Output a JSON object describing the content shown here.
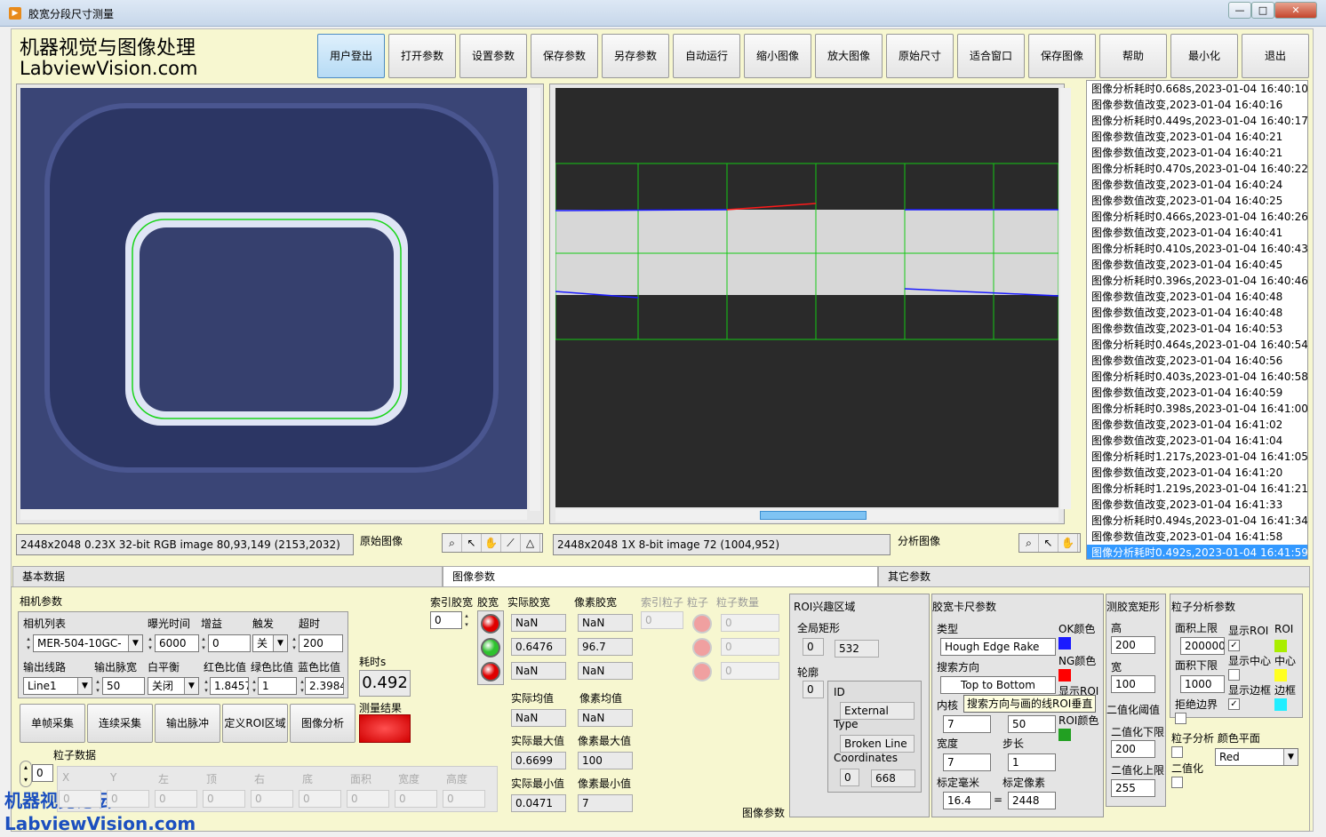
{
  "window": {
    "title": "胶宽分段尺寸测量",
    "min": "—",
    "max": "□",
    "close": "✕"
  },
  "brand": {
    "line1": "机器视觉与图像处理",
    "line2": "LabviewVision.com"
  },
  "toolbar": [
    "用户登出",
    "打开参数",
    "设置参数",
    "保存参数",
    "另存参数",
    "自动运行",
    "缩小图像",
    "放大图像",
    "原始尺寸",
    "适合窗口",
    "保存图像",
    "帮助",
    "最小化",
    "退出"
  ],
  "left_view": {
    "status": "2448x2048 0.23X 32-bit RGB image 80,93,149    (2153,2032)",
    "label": "原始图像"
  },
  "right_view": {
    "status": "2448x2048 1X 8-bit image 72    (1004,952)",
    "label": "分析图像"
  },
  "log": [
    "图像分析耗时0.668s,2023-01-04 16:40:10",
    "图像参数值改变,2023-01-04 16:40:16",
    "图像分析耗时0.449s,2023-01-04 16:40:17",
    "图像参数值改变,2023-01-04 16:40:21",
    "图像参数值改变,2023-01-04 16:40:21",
    "图像分析耗时0.470s,2023-01-04 16:40:22",
    "图像参数值改变,2023-01-04 16:40:24",
    "图像参数值改变,2023-01-04 16:40:25",
    "图像分析耗时0.466s,2023-01-04 16:40:26",
    "图像参数值改变,2023-01-04 16:40:41",
    "图像分析耗时0.410s,2023-01-04 16:40:43",
    "图像参数值改变,2023-01-04 16:40:45",
    "图像分析耗时0.396s,2023-01-04 16:40:46",
    "图像参数值改变,2023-01-04 16:40:48",
    "图像参数值改变,2023-01-04 16:40:48",
    "图像参数值改变,2023-01-04 16:40:53",
    "图像分析耗时0.464s,2023-01-04 16:40:54",
    "图像参数值改变,2023-01-04 16:40:56",
    "图像分析耗时0.403s,2023-01-04 16:40:58",
    "图像参数值改变,2023-01-04 16:40:59",
    "图像分析耗时0.398s,2023-01-04 16:41:00",
    "图像参数值改变,2023-01-04 16:41:02",
    "图像参数值改变,2023-01-04 16:41:04",
    "图像分析耗时1.217s,2023-01-04 16:41:05",
    "图像参数值改变,2023-01-04 16:41:20",
    "图像分析耗时1.219s,2023-01-04 16:41:21",
    "图像参数值改变,2023-01-04 16:41:33",
    "图像分析耗时0.494s,2023-01-04 16:41:34",
    "图像参数值改变,2023-01-04 16:41:58",
    "图像分析耗时0.492s,2023-01-04 16:41:59"
  ],
  "tabs": [
    "基本数据",
    "图像参数",
    "其它参数"
  ],
  "camera": {
    "title": "相机参数",
    "h_list": "相机列表",
    "h_exposure": "曝光时间",
    "h_gain": "增益",
    "h_trigger": "触发",
    "h_timeout": "超时",
    "cam": "MER-504-10GC-",
    "exposure": "6000",
    "gain": "0",
    "trigger": "关",
    "timeout": "200",
    "h_line": "输出线路",
    "h_pulse": "输出脉宽",
    "h_wb": "白平衡",
    "h_red": "红色比值",
    "h_green": "绿色比值",
    "h_blue": "蓝色比值",
    "line": "Line1",
    "pulse": "50",
    "wb": "关闭",
    "red": "1.8457",
    "green": "1",
    "blue": "2.3984",
    "idx": "0"
  },
  "buttons": [
    "单帧采集",
    "连续采集",
    "输出脉冲",
    "定义ROI区域",
    "图像分析"
  ],
  "timing": {
    "label": "耗时s",
    "value": "0.492",
    "result_label": "测量结果"
  },
  "particle": {
    "title": "粒子数据",
    "idx": "0",
    "cols": [
      "X",
      "Y",
      "左",
      "顶",
      "右",
      "底",
      "面积",
      "宽度",
      "高度"
    ],
    "vals": [
      "0",
      "0",
      "0",
      "0",
      "0",
      "0",
      "0",
      "0",
      "0"
    ]
  },
  "measure": {
    "h_index": "索引胶宽",
    "h_glue": "胶宽",
    "h_actual": "实际胶宽",
    "h_pixel": "像素胶宽",
    "index": "0",
    "actual": [
      "NaN",
      "0.6476",
      "NaN"
    ],
    "pixel": [
      "NaN",
      "96.7",
      "NaN"
    ],
    "h_amean": "实际均值",
    "h_pmean": "像素均值",
    "amean": "NaN",
    "pmean": "NaN",
    "h_amax": "实际最大值",
    "h_pmax": "像素最大值",
    "amax": "0.6699",
    "pmax": "100",
    "h_amin": "实际最小值",
    "h_pmin": "像素最小值",
    "amin": "0.0471",
    "pmin": "7",
    "h_pidx": "索引粒子",
    "h_part": "粒子",
    "h_pcount": "粒子数量",
    "pidx": "0",
    "pcount": [
      "0",
      "0",
      "0"
    ],
    "led_colors": [
      "#e00000",
      "#2ec22e",
      "#e00000"
    ]
  },
  "roi": {
    "title": "ROI兴趣区域",
    "global": "全局矩形",
    "g1": "0",
    "g2": "532",
    "contour": "轮廓",
    "c1": "0",
    "id": "ID",
    "id_val": "External",
    "type": "Type",
    "type_val": "Broken Line",
    "coords": "Coordinates",
    "co1": "0",
    "co2": "668"
  },
  "caliper": {
    "title": "胶宽卡尺参数",
    "h_type": "类型",
    "type": "Hough Edge Rake",
    "h_ok": "OK颜色",
    "h_dir": "搜索方向",
    "dir": "Top to Bottom",
    "h_ng": "NG颜色",
    "h_show": "显示ROI",
    "tooltip": "搜索方向与画的线ROI垂直",
    "h_inner": "内核",
    "h_roicolor": "ROI颜色",
    "inner": "7",
    "step_pre": "50",
    "h_width": "宽度",
    "h_step": "步长",
    "width": "7",
    "step": "1",
    "h_mm": "标定毫米",
    "h_px": "标定像素",
    "mm": "16.4",
    "eq": "=",
    "px": "2448",
    "footer": "图像参数",
    "ok_color": "#1a1aff",
    "ng_color": "#ff0000",
    "roi_color": "#22a022"
  },
  "rect": {
    "title": "测胶宽矩形",
    "h_h": "高",
    "h": "200",
    "h_w": "宽",
    "w": "100",
    "h_bin": "二值化阈值",
    "h_lo": "二值化下限",
    "lo": "200",
    "h_hi": "二值化上限",
    "hi": "255"
  },
  "part": {
    "title": "粒子分析参数",
    "h_amax": "面积上限",
    "amax": "200000",
    "h_amin": "面积下限",
    "amin": "1000",
    "h_rej": "拒绝边界",
    "h_show_roi": "显示ROI",
    "h_roi": "ROI",
    "h_center": "显示中心",
    "h_center2": "中心",
    "h_border": "显示边框",
    "h_border2": "边框",
    "h_plane": "粒子分析 颜色平面",
    "plane": "Red",
    "h_bin": "二值化",
    "roi_color": "#aaee00",
    "center_color": "#ffff22",
    "border_color": "#22eeff"
  },
  "watermark": {
    "line1": "机器视觉论坛",
    "line2": "LabviewVision.com"
  }
}
